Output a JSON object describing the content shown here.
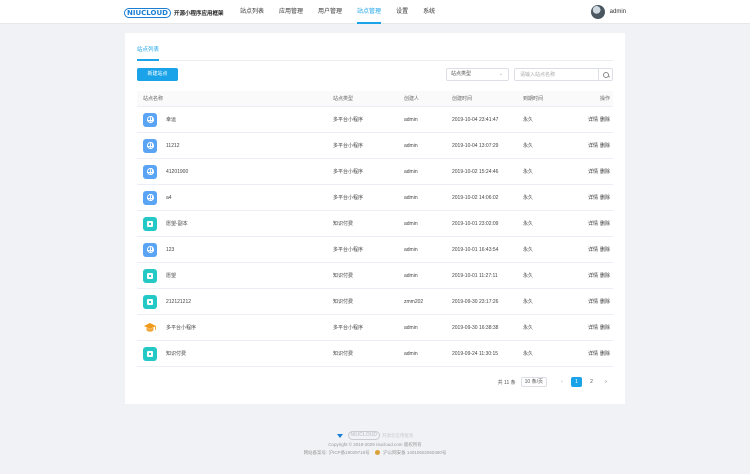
{
  "header": {
    "logo_mark": "NIUCLOUD",
    "logo_text": "开源小程序应用框架",
    "nav": [
      {
        "label": "站点列表",
        "active": false
      },
      {
        "label": "应用管理",
        "active": false
      },
      {
        "label": "用户管理",
        "active": false
      },
      {
        "label": "站点管理",
        "active": true
      },
      {
        "label": "设置",
        "active": false
      },
      {
        "label": "系统",
        "active": false
      }
    ],
    "user_name": "admin"
  },
  "tabs": {
    "active_label": "站点列表"
  },
  "toolbar": {
    "new_button_label": "新建站点",
    "type_select_value": "站点类型",
    "search_placeholder": "请输入站点名称"
  },
  "table": {
    "headers": {
      "name": "站点名称",
      "type": "站点类型",
      "creator": "创建人",
      "created": "创建时间",
      "expire": "到期时间",
      "ops": "操作"
    },
    "rows": [
      {
        "icon": "globe-icon",
        "name": "幸运",
        "type": "多平台小程序",
        "creator": "admin",
        "created": "2019-10-04 23:41:47",
        "expire": "永久",
        "op_detail": "详情",
        "op_delete": "删除"
      },
      {
        "icon": "globe-icon",
        "name": "11212",
        "type": "多平台小程序",
        "creator": "admin",
        "created": "2019-10-04 13:07:29",
        "expire": "永久",
        "op_detail": "详情",
        "op_delete": "删除"
      },
      {
        "icon": "globe-icon",
        "name": "41201900",
        "type": "多平台小程序",
        "creator": "admin",
        "created": "2019-10-02 15:24:46",
        "expire": "永久",
        "op_detail": "详情",
        "op_delete": "删除"
      },
      {
        "icon": "globe-icon",
        "name": "a4",
        "type": "多平台小程序",
        "creator": "admin",
        "created": "2019-10-02 14:06:02",
        "expire": "永久",
        "op_detail": "详情",
        "op_delete": "删除"
      },
      {
        "icon": "knowledge-icon",
        "name": "愿望-副本",
        "type": "知识付费",
        "creator": "admin",
        "created": "2019-10-01 23:02:09",
        "expire": "永久",
        "op_detail": "详情",
        "op_delete": "删除"
      },
      {
        "icon": "globe-icon",
        "name": "123",
        "type": "多平台小程序",
        "creator": "admin",
        "created": "2019-10-01 16:43:54",
        "expire": "永久",
        "op_detail": "详情",
        "op_delete": "删除"
      },
      {
        "icon": "knowledge-icon",
        "name": "愿望",
        "type": "知识付费",
        "creator": "admin",
        "created": "2019-10-01 11:27:11",
        "expire": "永久",
        "op_detail": "详情",
        "op_delete": "删除"
      },
      {
        "icon": "knowledge-icon",
        "name": "212121212",
        "type": "知识付费",
        "creator": "zmm202",
        "created": "2019-09-30 23:17:26",
        "expire": "永久",
        "op_detail": "详情",
        "op_delete": "删除"
      },
      {
        "icon": "graduation-cap-icon",
        "name": "多平台小程序",
        "type": "多平台小程序",
        "creator": "admin",
        "created": "2019-09-30 16:38:38",
        "expire": "永久",
        "op_detail": "详情",
        "op_delete": "删除"
      },
      {
        "icon": "knowledge-icon",
        "name": "知识付费",
        "type": "知识付费",
        "creator": "admin",
        "created": "2019-09-24 11:30:15",
        "expire": "永久",
        "op_detail": "详情",
        "op_delete": "删除"
      }
    ]
  },
  "pagination": {
    "total_text": "共 11 条",
    "page_size": "10 条/页",
    "pages": [
      "1",
      "2"
    ],
    "current_page": 1
  },
  "footer": {
    "logo_mark": "NIUCLOUD",
    "logo_text": "开源云应用框架",
    "copyright": "Copyright © 2019-2029 niucloud.com 版权所有",
    "icp": "网站备案号: 沪ICP备19029718号",
    "police": "沪公网安备 14010602060480号"
  },
  "colors": {
    "accent": "#1aa3e8",
    "globe_icon_bg": "#5aa4f5",
    "knowledge_icon_bg": "#24c9c6",
    "cap_icon": "#f09a1b"
  }
}
